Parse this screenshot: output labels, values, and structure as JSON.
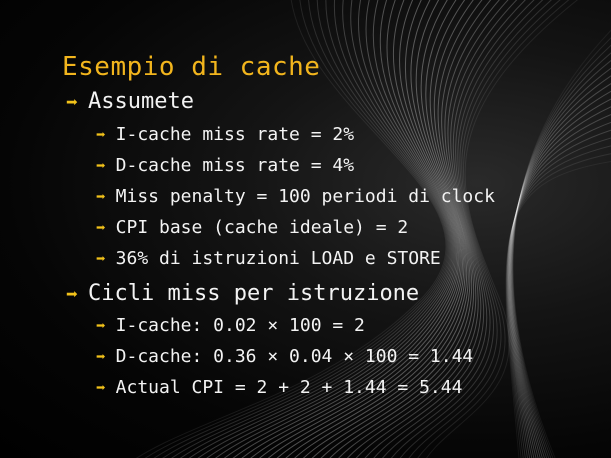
{
  "slide": {
    "title": "Esempio di cache",
    "sections": [
      {
        "label": "Assumete",
        "items": [
          "I-cache miss rate = 2%",
          "D-cache miss rate = 4%",
          "Miss penalty = 100 periodi di clock",
          "CPI base (cache ideale) = 2",
          "36% di istruzioni LOAD e STORE"
        ]
      },
      {
        "label": "Cicli miss per istruzione",
        "items": [
          "I-cache: 0.02 × 100 = 2",
          "D-cache: 0.36 × 0.04 × 100 = 1.44",
          "Actual CPI = 2 + 2 + 1.44 = 5.44"
        ]
      }
    ],
    "bullet_glyph": "➡",
    "colors": {
      "title": "#f2b51d",
      "bullet_arrow": "#f2c21a",
      "text": "#f3f3f3",
      "background": "#000000"
    }
  }
}
